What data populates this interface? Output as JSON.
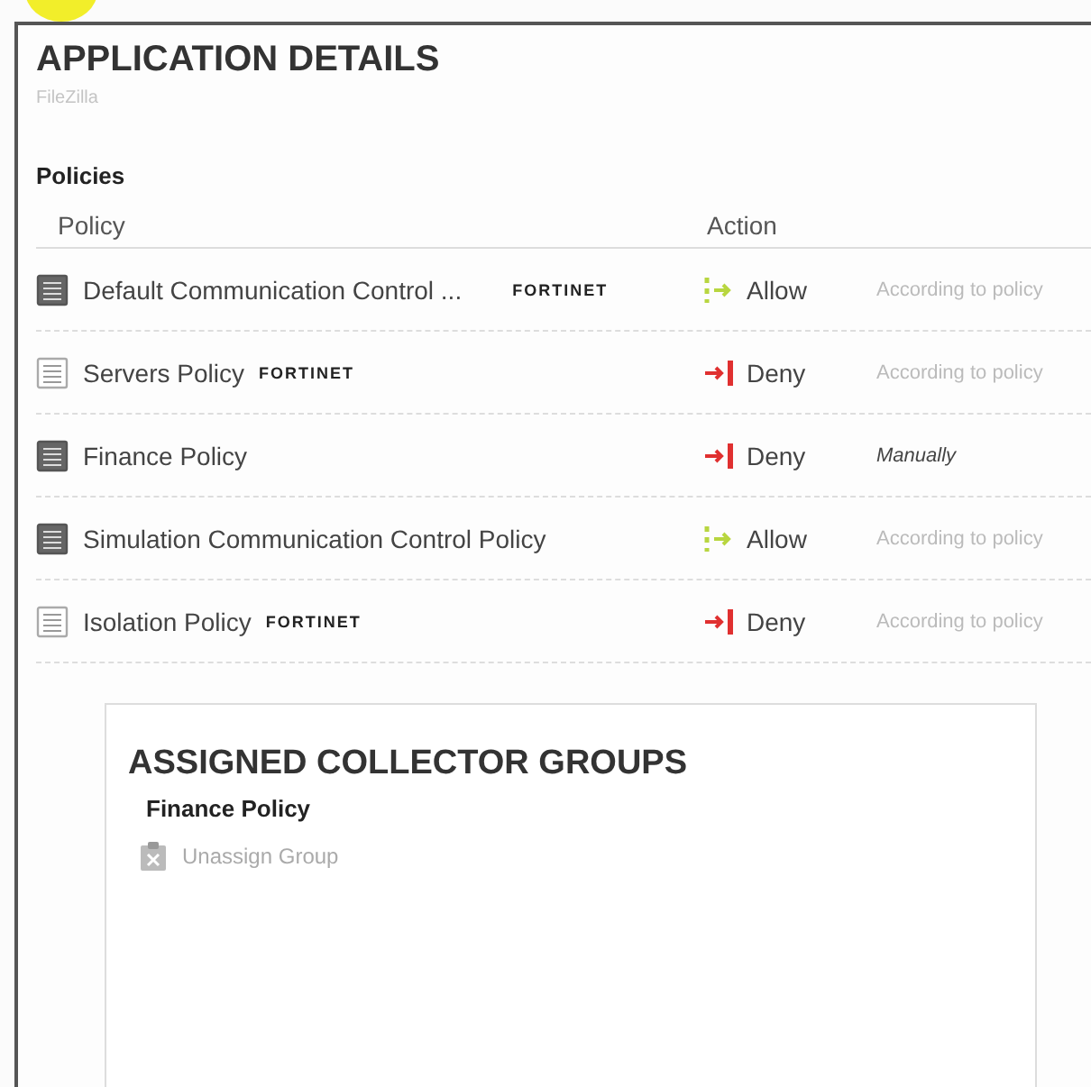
{
  "title": "APPLICATION DETAILS",
  "subtitle": "FileZilla",
  "policies": {
    "heading": "Policies",
    "columns": [
      "Policy",
      "Action"
    ],
    "rows": [
      {
        "name": "Default Communication Control ...",
        "kind": "filled",
        "vendor": "FORTINET",
        "action": {
          "label": "Allow",
          "kind": "allow"
        },
        "mode": {
          "label": "According to policy",
          "kind": "auto"
        }
      },
      {
        "name": "Servers Policy",
        "kind": "outline",
        "vendor": "FORTINET",
        "action": {
          "label": "Deny",
          "kind": "deny"
        },
        "mode": {
          "label": "According to policy",
          "kind": "auto"
        }
      },
      {
        "name": "Finance Policy",
        "kind": "filled",
        "action": {
          "label": "Deny",
          "kind": "deny"
        },
        "mode": {
          "label": "Manually",
          "kind": "manual"
        }
      },
      {
        "name": "Simulation Communication Control Policy",
        "kind": "filled",
        "action": {
          "label": "Allow",
          "kind": "allow"
        },
        "mode": {
          "label": "According to policy",
          "kind": "auto"
        }
      },
      {
        "name": "Isolation Policy",
        "kind": "outline",
        "vendor": "FORTINET",
        "action": {
          "label": "Deny",
          "kind": "deny"
        },
        "mode": {
          "label": "According to policy",
          "kind": "auto"
        }
      }
    ]
  },
  "collectors": {
    "heading": "ASSIGNED COLLECTOR GROUPS",
    "policy": "Finance Policy",
    "action": {
      "label": "Unassign Group",
      "disabled": true
    }
  }
}
